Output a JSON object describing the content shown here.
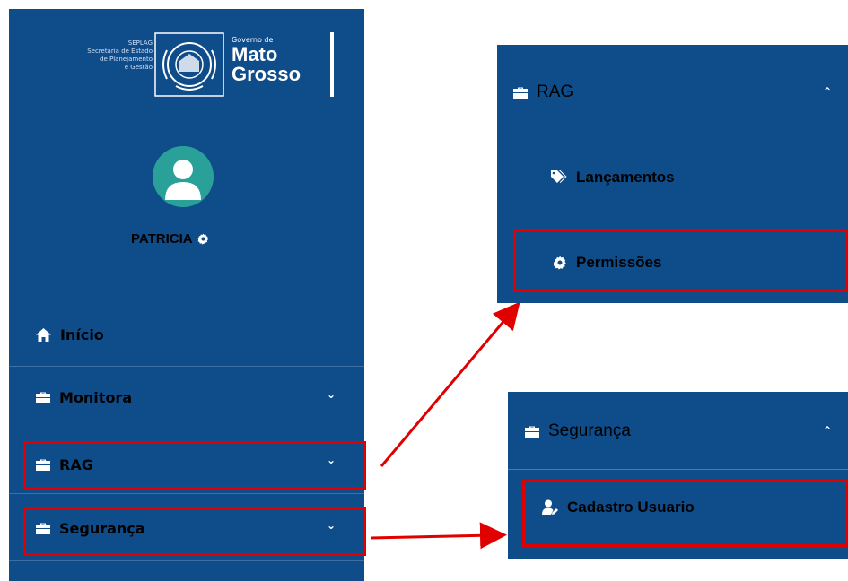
{
  "logo": {
    "small_lines": [
      "SEPLAG",
      "Secretaria de Estado",
      "de Planejamento",
      "e Gestão"
    ],
    "gov_label": "Governo de",
    "state_line1": "Mato",
    "state_line2": "Grosso"
  },
  "user": {
    "name": "PATRICIA",
    "settings_icon": "gear-icon",
    "avatar_icon": "user-avatar-icon"
  },
  "nav": {
    "inicio": "Início",
    "monitora": "Monitora",
    "rag": "RAG",
    "seguranca": "Segurança"
  },
  "rag_panel": {
    "title": "RAG",
    "items": [
      "Lançamentos",
      "Permissões"
    ]
  },
  "seguranca_panel": {
    "title": "Segurança",
    "items": [
      "Cadastro Usuario"
    ]
  },
  "colors": {
    "sidebar_bg": "#0f4c8a",
    "highlight": "#e00000",
    "avatar_bg": "#2aa198"
  }
}
